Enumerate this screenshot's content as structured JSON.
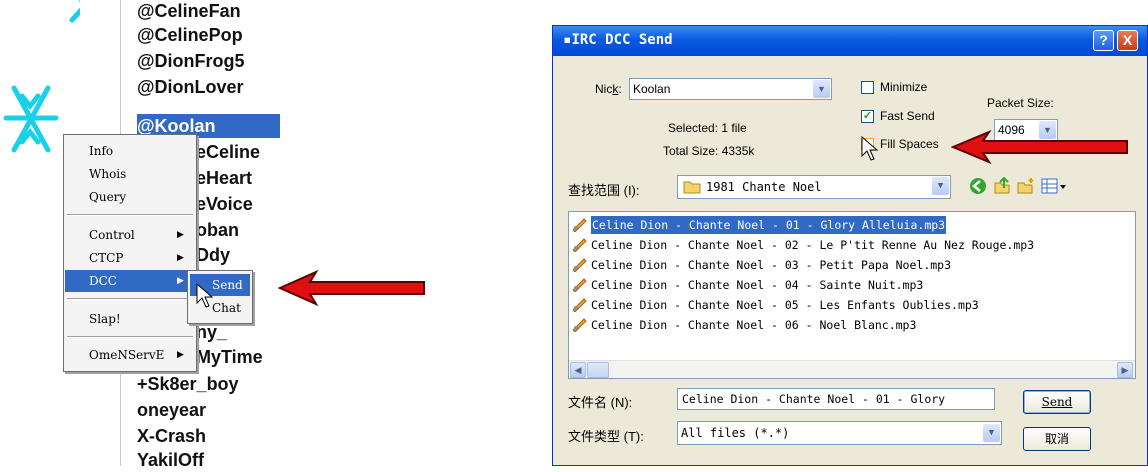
{
  "nicklist": {
    "nicks": [
      "@CelineFan",
      "@CelinePop",
      "@DionFrog5",
      "@DionLover",
      "@Koolan",
      "eCeline",
      "eHeart",
      "eVoice",
      "oban",
      "Ddy",
      "",
      "ny_",
      "MyTime",
      "+Sk8er_boy",
      "oneyear",
      "X-Crash",
      "YakilOff"
    ]
  },
  "context_menu": {
    "items": [
      {
        "label": "Info"
      },
      {
        "label": "Whois"
      },
      {
        "label": "Query"
      },
      {
        "label": "Control"
      },
      {
        "label": "CTCP"
      },
      {
        "label": "DCC"
      },
      {
        "label": "Slap!"
      },
      {
        "label": "OmeNServE"
      }
    ],
    "dcc_submenu": {
      "send": "Send",
      "chat": "Chat"
    }
  },
  "dialog": {
    "title": "IRC DCC Send",
    "help_glyph": "?",
    "close_glyph": "X",
    "nick_label_pre": "Nic",
    "nick_label_key": "k",
    "nick_label_post": ":",
    "nick_value": "Koolan",
    "selected_text": "Selected: 1 file",
    "total_size_text": "Total Size: 4335k",
    "minimize_label": "Minimize",
    "fast_send_label": "Fast Send",
    "fill_spaces_label": "Fill Spaces",
    "packet_size_label": "Packet Size:",
    "packet_size_value": "4096",
    "lookin_label": "查找范围 (I):",
    "lookin_value": "1981 Chante Noel",
    "files": [
      "Celine Dion - Chante Noel - 01 - Glory Alleluia.mp3",
      "Celine Dion - Chante Noel - 02 - Le P'tit Renne Au Nez Rouge.mp3",
      "Celine Dion - Chante Noel - 03 - Petit Papa Noel.mp3",
      "Celine Dion - Chante Noel - 04 - Sainte Nuit.mp3",
      "Celine Dion - Chante Noel - 05 - Les Enfants Oublies.mp3",
      "Celine Dion - Chante Noel - 06 - Noel Blanc.mp3"
    ],
    "filename_label": "文件名 (N):",
    "filename_value": "Celine Dion - Chante Noel - 01 - Glory",
    "filetype_label": "文件类型 (T):",
    "filetype_value": "All files (*.*)",
    "send_button": "Send",
    "cancel_button": "取消"
  },
  "colors": {
    "selection": "#316ac5",
    "arrow": "#e01010",
    "titlebar": "#0a5ae0",
    "dialog_bg": "#ece9d8"
  }
}
